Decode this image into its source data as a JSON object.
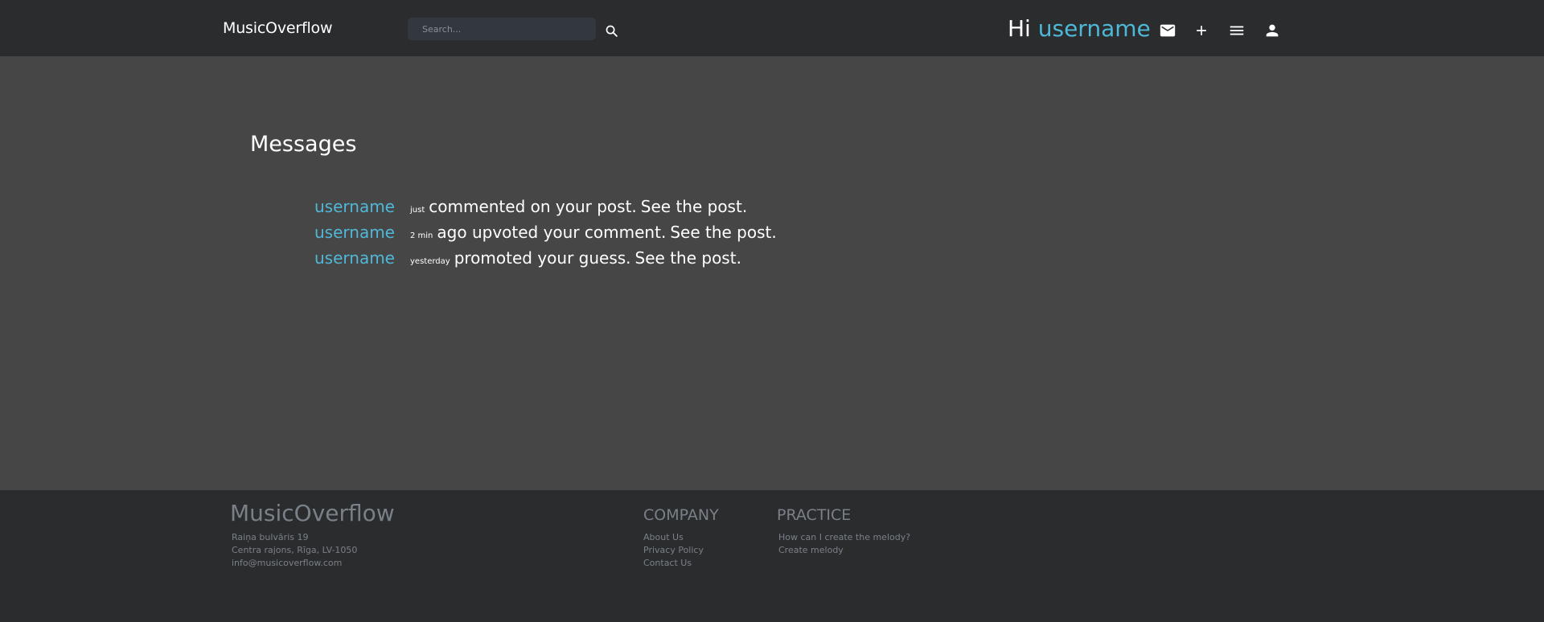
{
  "header": {
    "brand": "MusicOverflow",
    "search_placeholder": "Search...",
    "greeting_hi": "Hi",
    "greeting_username": "username",
    "icons": [
      "search-icon",
      "mail-icon",
      "plus-icon",
      "menu-icon",
      "person-icon"
    ]
  },
  "main": {
    "title": "Messages",
    "messages": [
      {
        "username": "username",
        "time": "just",
        "text": "commented on your post.",
        "link": "See the post."
      },
      {
        "username": "username",
        "time": "2 min",
        "text": "ago upvoted your comment.",
        "link": "See the post."
      },
      {
        "username": "username",
        "time": "yesterday",
        "text": "promoted your guess.",
        "link": "See the post."
      }
    ]
  },
  "footer": {
    "brand": "MusicOverflow",
    "address": [
      "Raiņa bulvāris 19",
      "Centra rajons, Rīga, LV-1050",
      "info@musicoverflow.com"
    ],
    "company": {
      "heading": "COMPANY",
      "links": [
        "About Us",
        "Privacy Policy",
        "Contact Us"
      ]
    },
    "practice": {
      "heading": "PRACTICE",
      "links": [
        "How can I create the melody?",
        "Create melody"
      ]
    }
  },
  "colors": {
    "accent": "#4fb8d6",
    "header_bg": "#2b2c2e",
    "page_bg": "#464646",
    "footer_text": "#7a8088"
  }
}
